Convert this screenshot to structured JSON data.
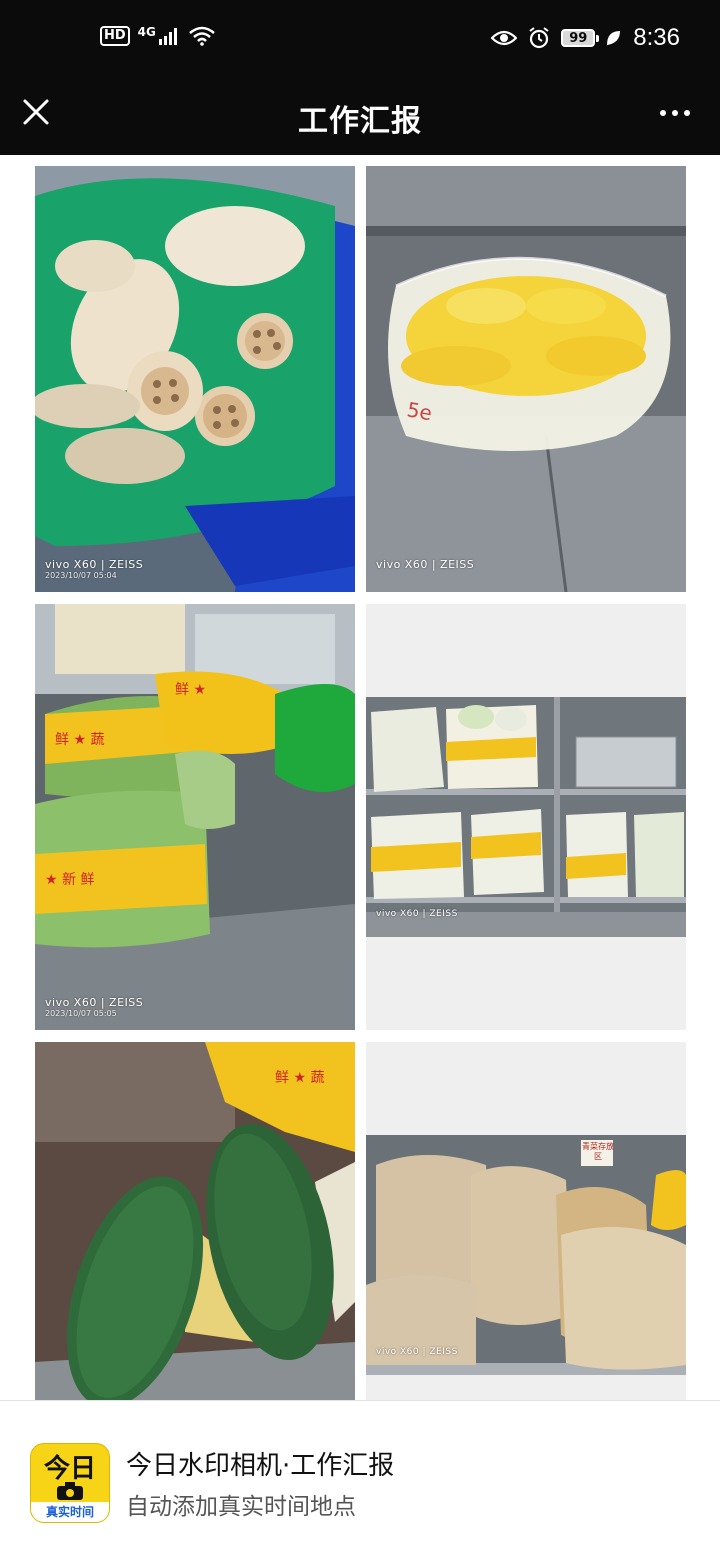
{
  "status_bar": {
    "hd": "HD",
    "network": "4G",
    "battery": "99",
    "time": "8:36",
    "icons": [
      "signal-icon",
      "wifi-icon",
      "eye-icon",
      "alarm-icon",
      "battery-icon",
      "leaf-icon"
    ]
  },
  "header": {
    "title": "工作汇报",
    "close_icon": "close-icon",
    "more_icon": "more-icon"
  },
  "photos": [
    {
      "subject": "lotus-root-bag",
      "brand": "vivo X60 | ZEISS",
      "date": "2023/10/07 05:04"
    },
    {
      "subject": "corn-bag",
      "brand": "vivo X60 | ZEISS",
      "date": ""
    },
    {
      "subject": "packed-greens",
      "brand": "vivo X60 | ZEISS",
      "date": "2023/10/07 05:05"
    },
    {
      "subject": "shelf-vegetables",
      "brand": "vivo X60 | ZEISS",
      "date": ""
    },
    {
      "subject": "winter-melon",
      "brand": "",
      "date": ""
    },
    {
      "subject": "ginger-bags",
      "brand": "vivo X60 | ZEISS",
      "date": "",
      "sign_text": "青菜存放区"
    }
  ],
  "banner": {
    "logo_top": "今日",
    "logo_bottom": "真实时间",
    "title": "今日水印相机·工作汇报",
    "subtitle": "自动添加真实时间地点"
  },
  "colors": {
    "bar": "#0b0b0b",
    "logo_yellow": "#f7d416",
    "logo_blue": "#1d5fd6"
  }
}
